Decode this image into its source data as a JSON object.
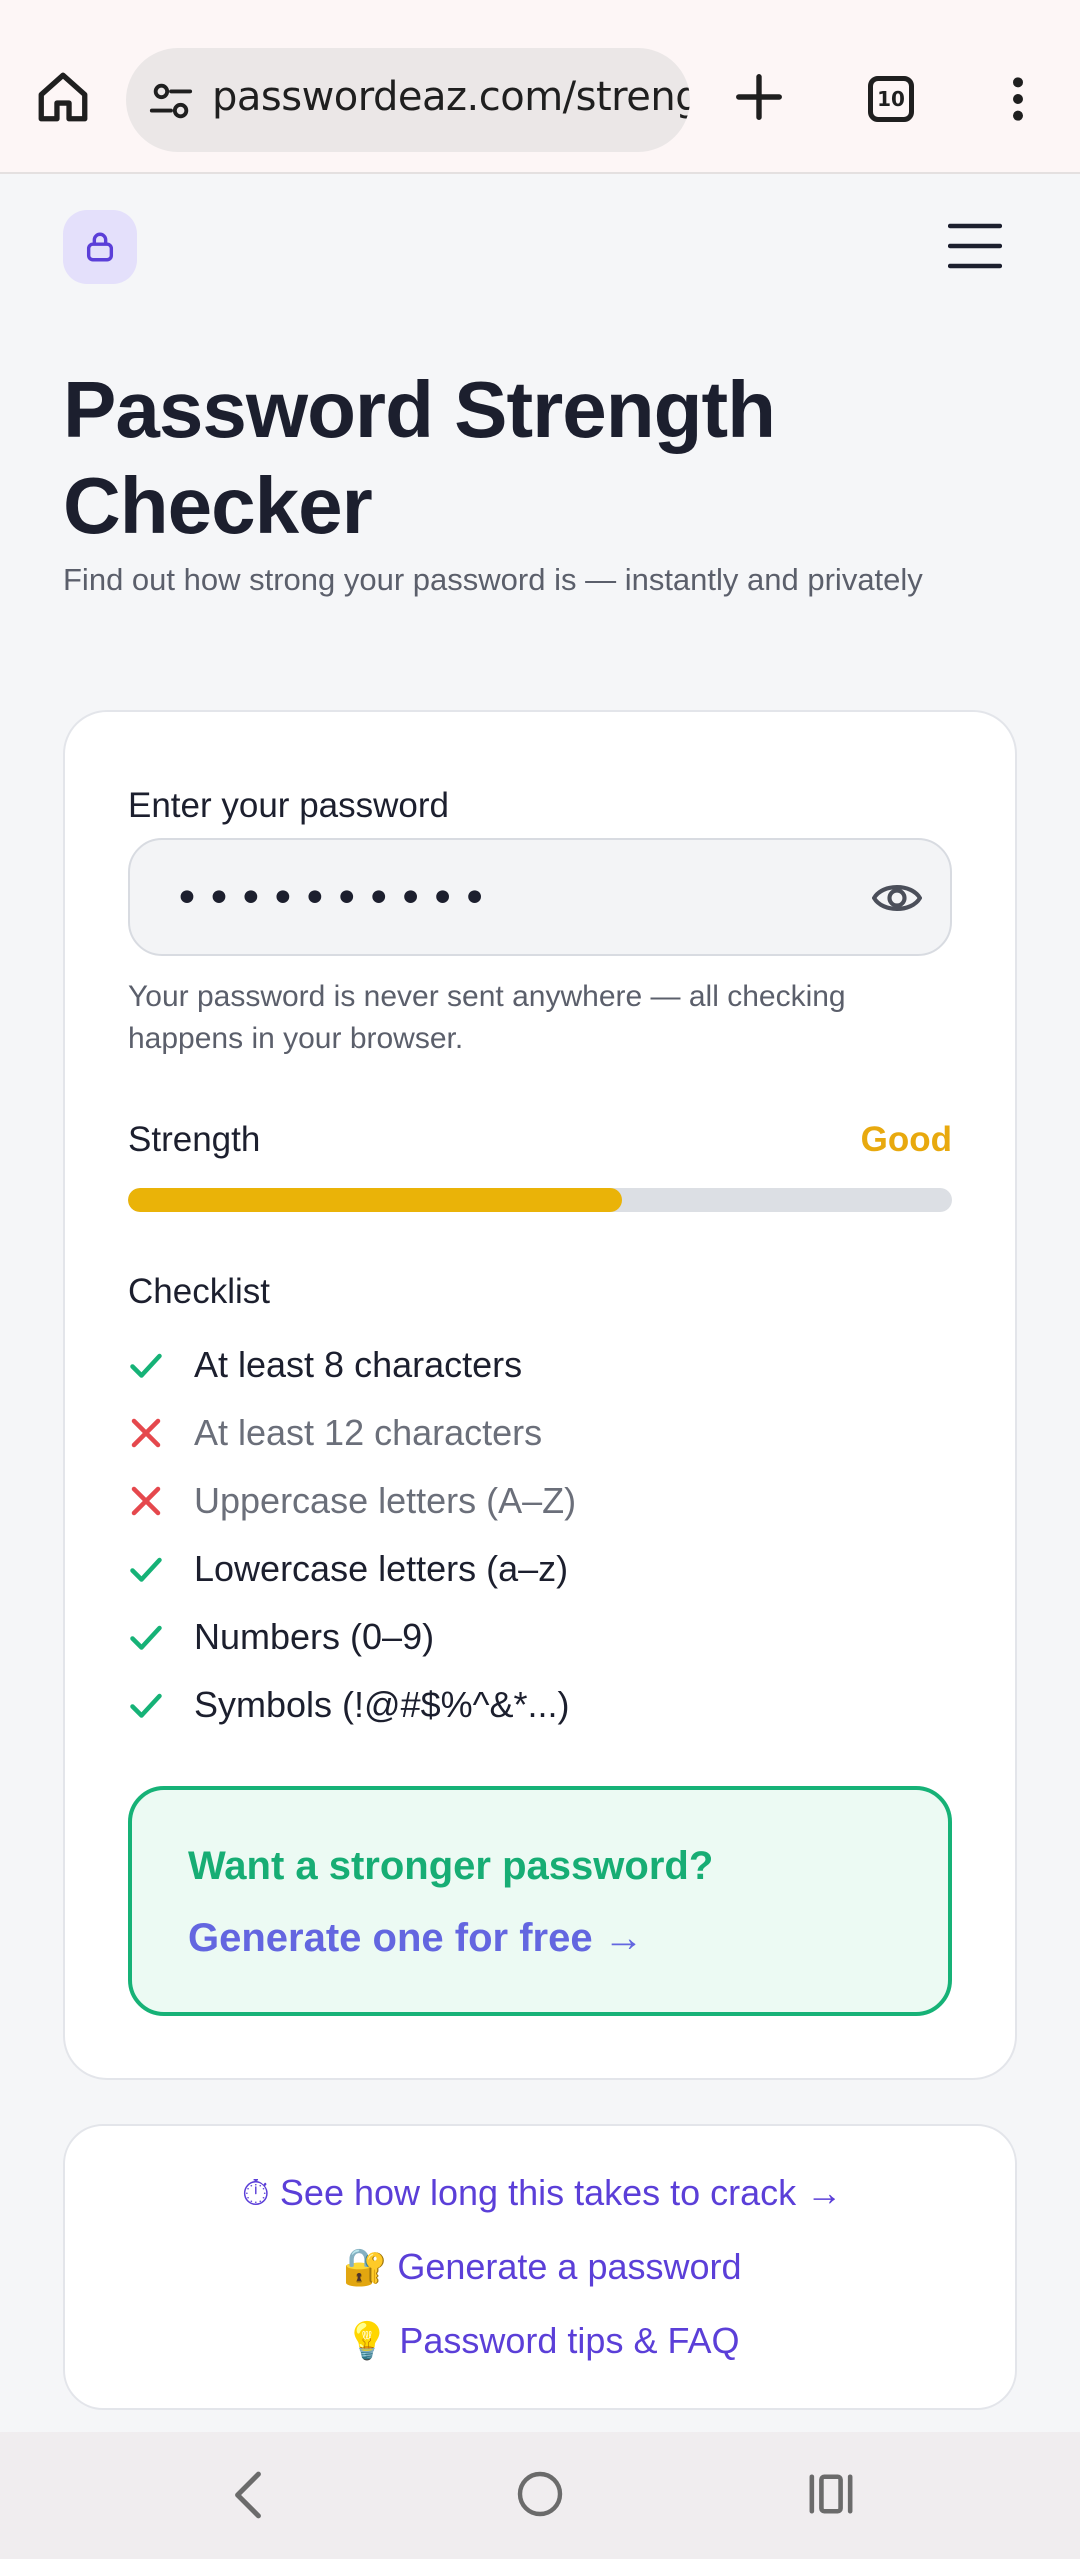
{
  "browser": {
    "url": "passwordeaz.com/strength",
    "tab_count": "10"
  },
  "header": {
    "title": "Password Strength Checker",
    "subtitle": "Find out how strong your password is — instantly and privately"
  },
  "form": {
    "label": "Enter your password",
    "value": "••••••••••",
    "privacy_note": "Your password is never sent anywhere — all checking happens in your browser."
  },
  "strength": {
    "label": "Strength",
    "rating": "Good",
    "level": 0.6,
    "color": "#eab308"
  },
  "checklist": {
    "title": "Checklist",
    "items": [
      {
        "label": "At least 8 characters",
        "met": true
      },
      {
        "label": "At least 12 characters",
        "met": false
      },
      {
        "label": "Uppercase letters (A–Z)",
        "met": false
      },
      {
        "label": "Lowercase letters (a–z)",
        "met": true
      },
      {
        "label": "Numbers (0–9)",
        "met": true
      },
      {
        "label": "Symbols (!@#$%^&*...)",
        "met": true
      }
    ]
  },
  "cta": {
    "heading": "Want a stronger password?",
    "link": "Generate one for free →"
  },
  "links": [
    {
      "icon": "⏱",
      "label": "See how long this takes to crack →"
    },
    {
      "icon": "🔐",
      "label": "Generate a password"
    },
    {
      "icon": "💡",
      "label": "Password tips & FAQ"
    }
  ],
  "colors": {
    "accent": "#6366e0",
    "success": "#16b277",
    "error": "#e5484d",
    "warning": "#eab308"
  },
  "icons": {
    "browser": [
      "home-icon",
      "site-settings-icon",
      "new-tab-icon",
      "tab-switcher-icon",
      "more-menu-icon"
    ],
    "site": [
      "lock-icon",
      "hamburger-menu-icon",
      "eye-icon",
      "check-icon",
      "cross-icon"
    ],
    "system": [
      "back-icon",
      "home-circle-icon",
      "recents-icon"
    ]
  }
}
